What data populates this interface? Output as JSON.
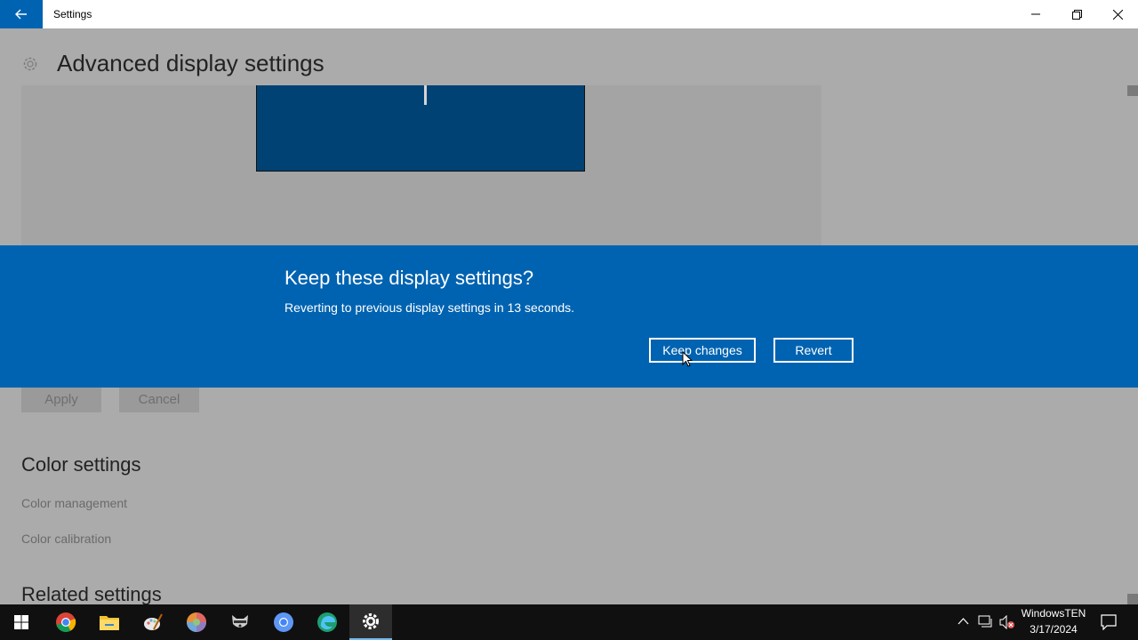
{
  "window": {
    "title": "Settings"
  },
  "page": {
    "title": "Advanced display settings"
  },
  "dialog": {
    "title": "Keep these display settings?",
    "message": "Reverting to previous display settings in 13 seconds.",
    "keep_label": "Keep changes",
    "revert_label": "Revert"
  },
  "actions": {
    "apply_label": "Apply",
    "cancel_label": "Cancel"
  },
  "color_settings": {
    "heading": "Color settings",
    "links": [
      "Color management",
      "Color calibration"
    ]
  },
  "related_settings": {
    "heading": "Related settings"
  },
  "taskbar": {
    "apps": [
      "chrome-icon",
      "file-explorer-icon",
      "paint-icon",
      "color-wheel-icon",
      "raccoon-icon",
      "chromium-icon",
      "edge-icon",
      "settings-icon"
    ],
    "clock": {
      "computer_name": "WindowsTEN",
      "date": "3/17/2024"
    }
  },
  "colors": {
    "accent": "#0063b1",
    "dim_bg": "#ababab",
    "taskbar": "#101010",
    "monitor": "#004273"
  }
}
